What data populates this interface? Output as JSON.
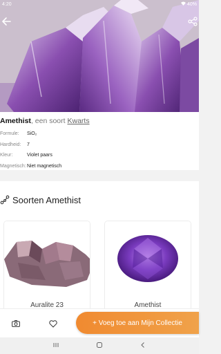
{
  "status": {
    "time": "4:20",
    "battery": "40%"
  },
  "header": {
    "back_icon": "arrow-left-icon",
    "share_icon": "share-icon"
  },
  "mineral": {
    "name": "Amethist",
    "type_prefix": ", een soort",
    "type_link": "Kwarts",
    "properties": [
      {
        "label": "Formule:",
        "value": "SiO₂"
      },
      {
        "label": "Hardheid:",
        "value": "7"
      },
      {
        "label": "Kleur:",
        "value": "Violet paars"
      },
      {
        "label": "Magnetisch:",
        "value": "Niet magnetisch"
      }
    ]
  },
  "varieties": {
    "title": "Soorten Amethist",
    "items": [
      {
        "name": "Auralite 23"
      },
      {
        "name": "Amethist"
      }
    ]
  },
  "actions": {
    "camera_icon": "camera-icon",
    "favorite_icon": "heart-icon",
    "add_label": "+ Voeg toe aan Mijn Collectie"
  },
  "colors": {
    "accent": "#f08a30",
    "amethyst": "#6a2d9c"
  }
}
